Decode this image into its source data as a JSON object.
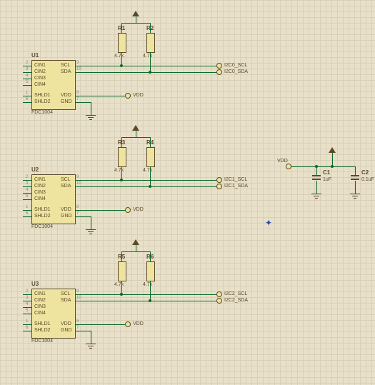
{
  "chart_data": {
    "type": "schematic",
    "components": [
      {
        "ref": "U1",
        "part": "FDC1004",
        "pins": {
          "2": "CIN1",
          "3": "CIN2",
          "4": "CIN3",
          "5": "CIN4",
          "1": "SHLD1",
          "6": "SHLD2",
          "9": "SCL",
          "10": "SDA",
          "8": "VDD",
          "7": "GND"
        }
      },
      {
        "ref": "U2",
        "part": "FDC1004",
        "pins": {
          "2": "CIN1",
          "3": "CIN2",
          "4": "CIN3",
          "5": "CIN4",
          "1": "SHLD1",
          "6": "SHLD2",
          "9": "SCL",
          "10": "SDA",
          "8": "VDD",
          "7": "GND"
        }
      },
      {
        "ref": "U3",
        "part": "FDC1004",
        "pins": {
          "2": "CIN1",
          "3": "CIN2",
          "4": "CIN3",
          "5": "CIN4",
          "1": "SHLD1",
          "6": "SHLD2",
          "9": "SCL",
          "10": "SDA",
          "8": "VDD",
          "7": "GND"
        }
      },
      {
        "ref": "R1",
        "value": "4.7k"
      },
      {
        "ref": "R2",
        "value": "4.7k"
      },
      {
        "ref": "R3",
        "value": "4.7k"
      },
      {
        "ref": "R4",
        "value": "4.7k"
      },
      {
        "ref": "R5",
        "value": "4.7k"
      },
      {
        "ref": "R6",
        "value": "4.7k"
      },
      {
        "ref": "C1",
        "value": "1uF"
      },
      {
        "ref": "C2",
        "value": "0.1uF"
      }
    ],
    "nets": [
      {
        "name": "I2C0_SCL",
        "from": "U1.SCL",
        "pullup": "R1",
        "to": "terminal"
      },
      {
        "name": "I2C0_SDA",
        "from": "U1.SDA",
        "pullup": "R2",
        "to": "terminal"
      },
      {
        "name": "I2C1_SCL",
        "from": "U2.SCL",
        "pullup": "R3",
        "to": "terminal"
      },
      {
        "name": "I2C1_SDA",
        "from": "U2.SDA",
        "pullup": "R4",
        "to": "terminal"
      },
      {
        "name": "I2C2_SCL",
        "from": "U3.SCL",
        "pullup": "R5",
        "to": "terminal"
      },
      {
        "name": "I2C2_SDA",
        "from": "U3.SDA",
        "pullup": "R6",
        "to": "terminal"
      },
      {
        "name": "VDD",
        "connects": [
          "U1.VDD",
          "U2.VDD",
          "U3.VDD",
          "R1",
          "R2",
          "R3",
          "R4",
          "R5",
          "R6",
          "C1",
          "C2"
        ]
      },
      {
        "name": "GND",
        "connects": [
          "U1.GND",
          "U2.GND",
          "U3.GND",
          "C1",
          "C2"
        ]
      }
    ]
  },
  "u1": {
    "ref": "U1",
    "part": "FDC1004"
  },
  "u2": {
    "ref": "U2",
    "part": "FDC1004"
  },
  "u3": {
    "ref": "U3",
    "part": "FDC1004"
  },
  "pins": {
    "cin1": "CIN1",
    "cin2": "CIN2",
    "cin3": "CIN3",
    "cin4": "CIN4",
    "shld1": "SHLD1",
    "shld2": "SHLD2",
    "scl": "SCL",
    "sda": "SDA",
    "vdd": "VDD",
    "gnd": "GND"
  },
  "pn": {
    "1": "1",
    "2": "2",
    "3": "3",
    "4": "4",
    "5": "5",
    "6": "6",
    "7": "7",
    "8": "8",
    "9": "9",
    "10": "10"
  },
  "r": {
    "r1": "R1",
    "r2": "R2",
    "r3": "R3",
    "r4": "R4",
    "r5": "R5",
    "r6": "R6",
    "v": "4.7k"
  },
  "c": {
    "c1": "C1",
    "c2": "C2",
    "v1": "1uF",
    "v2": "0.1uF"
  },
  "net": {
    "vdd": "VDD",
    "scl0": "I2C0_SCL",
    "sda0": "I2C0_SDA",
    "scl1": "I2C1_SCL",
    "sda1": "I2C1_SDA",
    "scl2": "I2C2_SCL",
    "sda2": "I2C2_SDA"
  }
}
